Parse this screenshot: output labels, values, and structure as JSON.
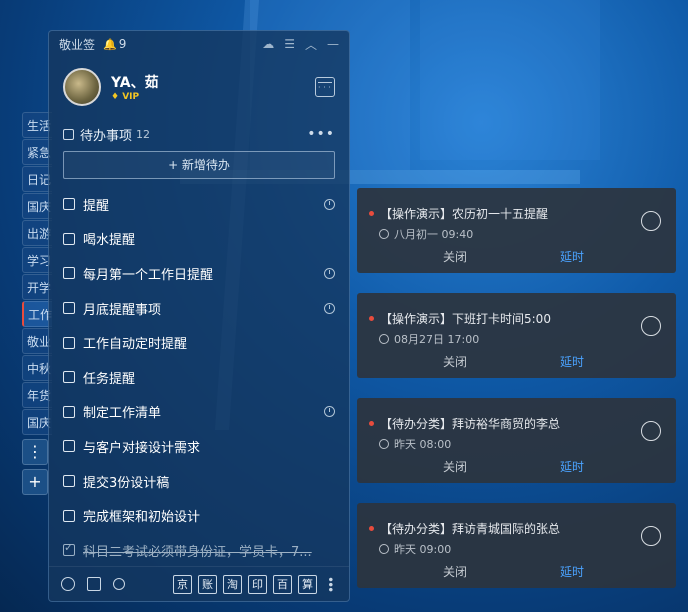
{
  "app": {
    "name": "敬业签",
    "notification_count": "9"
  },
  "side_tabs": [
    "生活",
    "紧急",
    "日记",
    "国庆",
    "出游",
    "学习",
    "开学",
    "工作",
    "敬业",
    "中秋",
    "年货",
    "国庆"
  ],
  "side_buttons": {
    "more": "⋮",
    "add": "+"
  },
  "user": {
    "name": "YA、茹",
    "badge": "VIP"
  },
  "todo_section": {
    "title": "待办事项",
    "count": "12",
    "more": "•••",
    "add_label": "+ 新增待办"
  },
  "todos": [
    {
      "text": "提醒",
      "clock": true
    },
    {
      "text": "喝水提醒",
      "clock": false
    },
    {
      "text": "每月第一个工作日提醒",
      "clock": true
    },
    {
      "text": "月底提醒事项",
      "clock": true
    },
    {
      "text": "工作自动定时提醒",
      "clock": false
    },
    {
      "text": "任务提醒",
      "clock": false
    },
    {
      "text": "制定工作清单",
      "clock": true
    },
    {
      "text": "与客户对接设计需求",
      "clock": false
    },
    {
      "text": "提交3份设计稿",
      "clock": false
    },
    {
      "text": "完成框架和初始设计",
      "clock": false
    },
    {
      "text": "科目二考试必须带身份证，学员卡，7...",
      "clock": false,
      "done": true
    }
  ],
  "bottom_tools": [
    "京",
    "账",
    "淘",
    "印",
    "百",
    "算"
  ],
  "cards": [
    {
      "title": "【操作演示】农历初一十五提醒",
      "time": "八月初一  09:40",
      "close": "关闭",
      "delay": "延时"
    },
    {
      "title": "【操作演示】下班打卡时间5:00",
      "time": "08月27日  17:00",
      "close": "关闭",
      "delay": "延时"
    },
    {
      "title": "【待办分类】拜访裕华商贸的李总",
      "time": "昨天  08:00",
      "close": "关闭",
      "delay": "延时"
    },
    {
      "title": "【待办分类】拜访青城国际的张总",
      "time": "昨天  09:00",
      "close": "关闭",
      "delay": "延时"
    }
  ]
}
